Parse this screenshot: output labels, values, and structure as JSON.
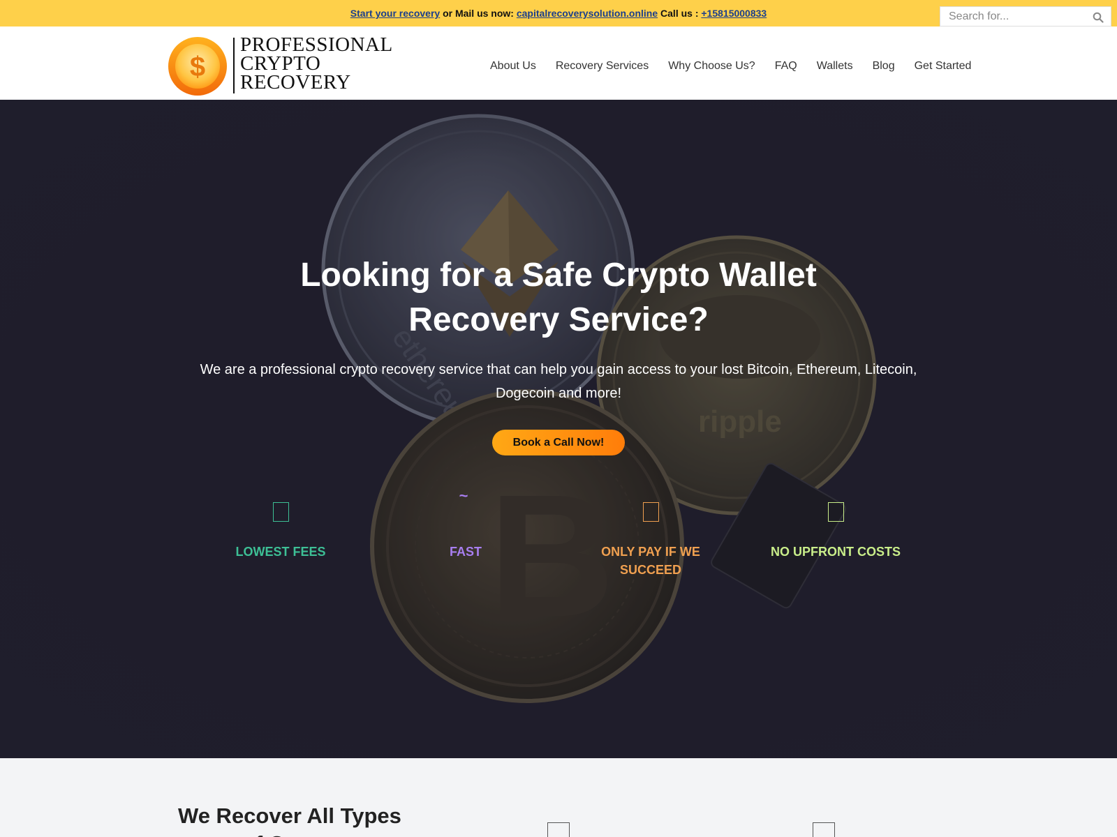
{
  "topbar": {
    "start_link": "Start your recovery",
    "or_text": " or Mail us now: ",
    "email": "capitalrecoverysolution.online",
    "call_text": " Call us : ",
    "phone": "+15815000833"
  },
  "search": {
    "placeholder": "Search for..."
  },
  "logo": {
    "line1": "PROFESSIONAL",
    "line2": "CRYPTO",
    "line3": "RECOVERY",
    "symbol": "$"
  },
  "nav": {
    "items": [
      {
        "label": "About Us"
      },
      {
        "label": "Recovery Services"
      },
      {
        "label": "Why Choose Us?"
      },
      {
        "label": "FAQ"
      },
      {
        "label": "Wallets"
      },
      {
        "label": "Blog"
      },
      {
        "label": "Get Started"
      }
    ]
  },
  "hero": {
    "title_line1": "Looking for a Safe Crypto Wallet",
    "title_line2": "Recovery Service?",
    "subtitle": "We are a professional crypto recovery service that can help you gain access to your lost Bitcoin, Ethereum, Litecoin, Dogecoin and more!",
    "cta": "Book a Call Now!",
    "coin_text_1": "ripple",
    "coin_text_2": "ethereum"
  },
  "features": [
    {
      "label": "LOWEST FEES",
      "color": "#3dbf95"
    },
    {
      "label": "FAST",
      "color": "#a87ef0",
      "glyph": "~"
    },
    {
      "label": "ONLY PAY IF WE SUCCEED",
      "color": "#f0a050"
    },
    {
      "label": "NO UPFRONT COSTS",
      "color": "#c9ee8a"
    }
  ],
  "bottom": {
    "title_line1": "We Recover All Types",
    "title_line2": "of Crypto"
  },
  "colors": {
    "topbar": "#fed04a",
    "cta_start": "#ffa815",
    "cta_end": "#ff7d0a",
    "hero_bg": "#1f1e2c"
  }
}
